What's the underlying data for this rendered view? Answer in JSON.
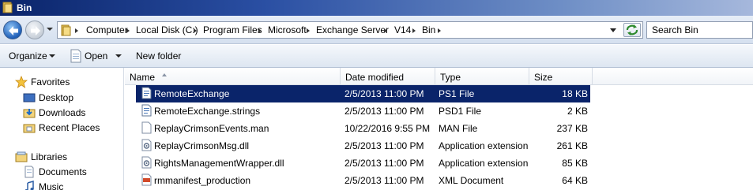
{
  "window": {
    "title": "Bin"
  },
  "address": {
    "breadcrumbs": [
      "Computer",
      "Local Disk (C:)",
      "Program Files",
      "Microsoft",
      "Exchange Server",
      "V14",
      "Bin"
    ],
    "search_placeholder": "Search Bin"
  },
  "toolbar": {
    "organize": "Organize",
    "open": "Open",
    "new_folder": "New folder"
  },
  "nav": {
    "favorites": "Favorites",
    "desktop": "Desktop",
    "downloads": "Downloads",
    "recent": "Recent Places",
    "libraries": "Libraries",
    "documents": "Documents",
    "music": "Music"
  },
  "columns": {
    "name": "Name",
    "date": "Date modified",
    "type": "Type",
    "size": "Size"
  },
  "files": [
    {
      "name": "RemoteExchange",
      "date": "2/5/2013 11:00 PM",
      "type": "PS1 File",
      "size": "18 KB",
      "icon": "script-icon",
      "selected": true
    },
    {
      "name": "RemoteExchange.strings",
      "date": "2/5/2013 11:00 PM",
      "type": "PSD1 File",
      "size": "2 KB",
      "icon": "script-icon",
      "selected": false
    },
    {
      "name": "ReplayCrimsonEvents.man",
      "date": "10/22/2016 9:55 PM",
      "type": "MAN File",
      "size": "237 KB",
      "icon": "document-icon",
      "selected": false
    },
    {
      "name": "ReplayCrimsonMsg.dll",
      "date": "2/5/2013 11:00 PM",
      "type": "Application extension",
      "size": "261 KB",
      "icon": "dll-icon",
      "selected": false
    },
    {
      "name": "RightsManagementWrapper.dll",
      "date": "2/5/2013 11:00 PM",
      "type": "Application extension",
      "size": "85 KB",
      "icon": "dll-icon",
      "selected": false
    },
    {
      "name": "rmmanifest_production",
      "date": "2/5/2013 11:00 PM",
      "type": "XML Document",
      "size": "64 KB",
      "icon": "xml-icon",
      "selected": false
    }
  ],
  "colors": {
    "selection": "#0a246a",
    "title_bar": "#0a246a"
  }
}
